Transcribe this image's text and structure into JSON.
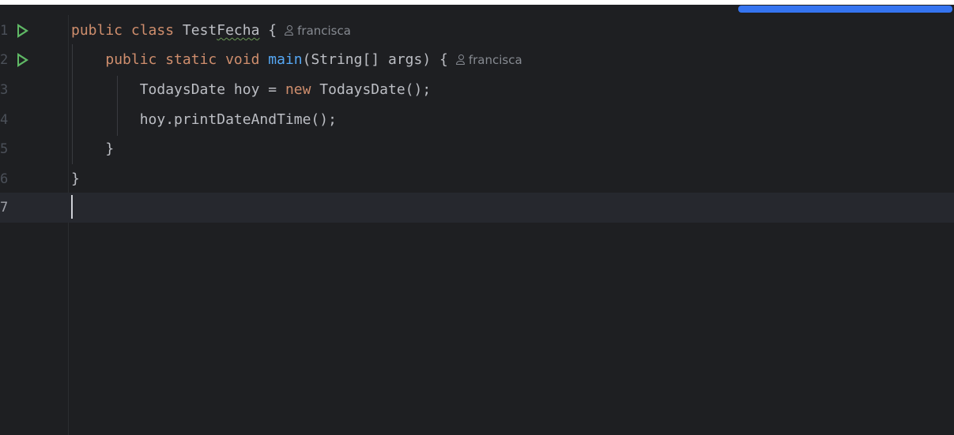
{
  "editor": {
    "author_label": "francisca",
    "lines": [
      {
        "number": "1",
        "has_run": true,
        "kw1": "public class ",
        "name": "Test",
        "name_warn": "Fecha",
        "rest": " {"
      },
      {
        "number": "2",
        "has_run": true,
        "indent": "    ",
        "kw1": "public static void ",
        "fn": "main",
        "rest": "(String[] args) {"
      },
      {
        "number": "3",
        "has_run": false,
        "pre": "        TodaysDate hoy = ",
        "kw1": "new",
        "rest": " TodaysDate();"
      },
      {
        "number": "4",
        "has_run": false,
        "text": "        hoy.printDateAndTime();"
      },
      {
        "number": "5",
        "has_run": false,
        "text": "    }"
      },
      {
        "number": "6",
        "has_run": false,
        "text": "}"
      },
      {
        "number": "7",
        "has_run": false,
        "text": ""
      }
    ]
  }
}
